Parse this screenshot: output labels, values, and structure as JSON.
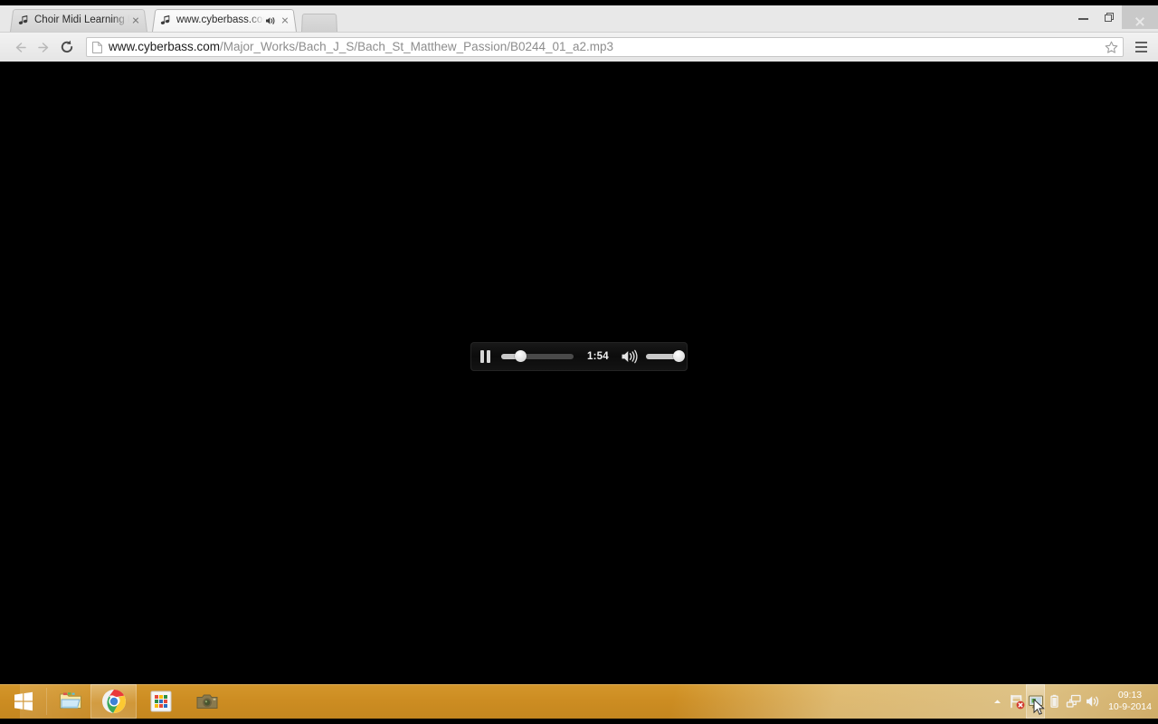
{
  "browser": {
    "tabs": [
      {
        "title": "Choir Midi Learning Files -",
        "favicon": "music-note-icon",
        "active": false,
        "audio_playing": false
      },
      {
        "title": "www.cyberbass.com/M",
        "favicon": "music-note-icon",
        "active": true,
        "audio_playing": true
      }
    ],
    "new_tab_label": "",
    "window_controls": {
      "minimize": "minimize-icon",
      "maximize": "restore-icon",
      "close": "close-icon"
    },
    "toolbar": {
      "back": "back-arrow-icon",
      "forward": "forward-arrow-icon",
      "reload": "reload-icon",
      "page_icon": "document-icon",
      "url_host": "www.cyberbass.com",
      "url_path": "/Major_Works/Bach_J_S/Bach_St_Matthew_Passion/B0244_01_a2.mp3",
      "url_full": "www.cyberbass.com/Major_Works/Bach_J_S/Bach_St_Matthew_Passion/B0244_01_a2.mp3",
      "bookmark": "star-icon",
      "menu": "hamburger-menu-icon"
    }
  },
  "page": {
    "background": "#000000",
    "player": {
      "state": "playing",
      "play_pause_icon": "pause-icon",
      "current_time": "1:54",
      "progress_percent": 27,
      "volume_percent": 88,
      "volume_icon": "speaker-on-icon",
      "panel_color": "#111111"
    }
  },
  "taskbar": {
    "accent_color": "#cd8d22",
    "start_button": "windows-start-icon",
    "items": [
      {
        "name": "file-explorer-icon",
        "active": false
      },
      {
        "name": "google-chrome-icon",
        "active": true
      },
      {
        "name": "store-grid-icon",
        "active": false
      },
      {
        "name": "camera-icon",
        "active": false
      }
    ],
    "tray": {
      "overflow": "chevron-up-icon",
      "icons": [
        {
          "name": "action-center-flag-icon",
          "highlighted": false
        },
        {
          "name": "display-settings-icon",
          "highlighted": true
        },
        {
          "name": "battery-icon",
          "highlighted": false
        },
        {
          "name": "network-icon",
          "highlighted": false
        },
        {
          "name": "volume-icon",
          "highlighted": false
        }
      ],
      "clock_time": "09:13",
      "clock_date": "10-9-2014"
    }
  }
}
